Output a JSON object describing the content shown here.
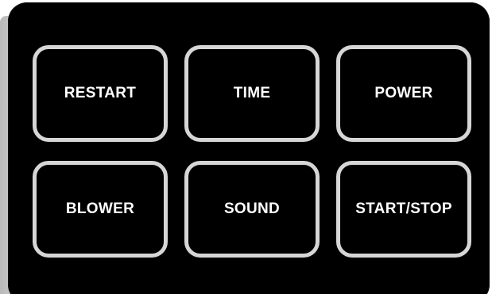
{
  "control_panel": {
    "buttons": [
      {
        "label": "RESTART"
      },
      {
        "label": "TIME"
      },
      {
        "label": "POWER"
      },
      {
        "label": "BLOWER"
      },
      {
        "label": "SOUND"
      },
      {
        "label": "START/STOP"
      }
    ]
  },
  "colors": {
    "panel_background": "#000000",
    "button_border": "#d6d6d6",
    "label_text": "#ffffff",
    "panel_edge": "#c4c4c4"
  }
}
